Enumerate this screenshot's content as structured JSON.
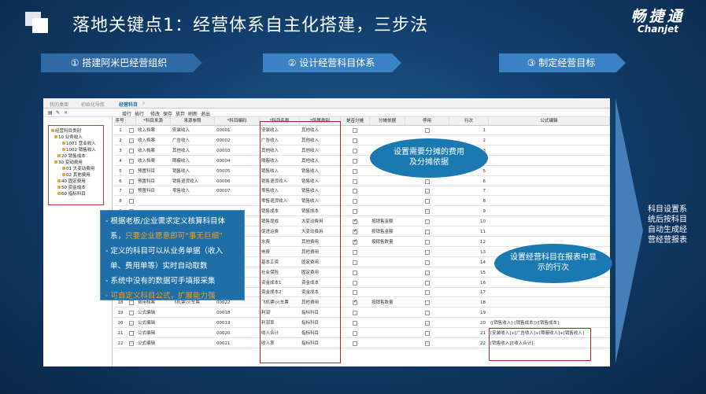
{
  "slide": {
    "title": "落地关键点1：经营体系自主化搭建，三步法",
    "brand_cn": "畅捷通",
    "brand_en": "Chanjet"
  },
  "steps": [
    "① 搭建阿米巴经营组织",
    "② 设计经营科目体系",
    "③ 制定经营目标"
  ],
  "app": {
    "tabs": [
      "我的桌面",
      "初始化导航",
      "经营科目"
    ],
    "toolbar": [
      "增行",
      "插行",
      "修改",
      "保存",
      "放弃",
      "刷新",
      "退出"
    ],
    "tree": [
      "经营科目类别",
      "10 业务收入",
      "1001 营业收入",
      "1002 销售收入",
      "20 销售成本",
      "30 变动费用",
      "01 大变动费用",
      "02 其他费用",
      "40 固定费用",
      "50 资金成本",
      "60 指标科目"
    ],
    "headers": [
      "序号",
      "",
      "*科目来源",
      "来源参照",
      "*科目编码",
      "*科目名称",
      "*所属类别",
      "是否分摊",
      "分摊依据",
      "停用",
      "行次",
      "公式编辑"
    ],
    "rows": [
      [
        "1",
        "收入档案",
        "安装收入",
        "00001",
        "安装收入",
        "其他收入",
        "",
        "",
        "1",
        ""
      ],
      [
        "2",
        "收入档案",
        "广告收入",
        "00002",
        "广告收入",
        "其他收入",
        "",
        "",
        "2",
        ""
      ],
      [
        "3",
        "收入档案",
        "其他收入",
        "00003",
        "其他收入",
        "其他收入",
        "",
        "",
        "3",
        ""
      ],
      [
        "4",
        "收入档案",
        "障蔽收入",
        "00004",
        "障蔽收入",
        "其他收入",
        "",
        "",
        "4",
        ""
      ],
      [
        "5",
        "预置科目",
        "销售收入",
        "00005",
        "销售收入",
        "销售收入",
        "",
        "",
        "5",
        ""
      ],
      [
        "6",
        "预置科目",
        "销售退货收入",
        "00006",
        "销售退货收入",
        "销售收入",
        "",
        "",
        "6",
        ""
      ],
      [
        "7",
        "预置科目",
        "零售收入",
        "00007",
        "零售收入",
        "销售收入",
        "",
        "",
        "7",
        ""
      ],
      [
        "8",
        "",
        "",
        "",
        "零售退货收入",
        "销售收入",
        "",
        "",
        "8",
        ""
      ],
      [
        "9",
        "",
        "",
        "",
        "销售成本",
        "销售成本",
        "",
        "",
        "9",
        ""
      ],
      [
        "10",
        "",
        "",
        "",
        "销售提成",
        "大变动费用",
        "on",
        "按销售金额",
        "10",
        ""
      ],
      [
        "11",
        "",
        "",
        "",
        "促进运费",
        "大变动费用",
        "on",
        "按销售金额",
        "11",
        ""
      ],
      [
        "12",
        "",
        "",
        "",
        "水费",
        "其他费用",
        "on",
        "按销售数量",
        "12",
        ""
      ],
      [
        "13",
        "",
        "",
        "",
        "电费",
        "其他费用",
        "",
        "",
        "13",
        ""
      ],
      [
        "14",
        "",
        "",
        "",
        "基本工资",
        "固定费用",
        "",
        "",
        "14",
        ""
      ],
      [
        "15",
        "",
        "",
        "",
        "社会保险",
        "固定费用",
        "",
        "",
        "15",
        ""
      ],
      [
        "16",
        "",
        "",
        "",
        "资金成本1",
        "资金成本",
        "",
        "",
        "16",
        ""
      ],
      [
        "17",
        "手工编报",
        "",
        "00017",
        "资金成本2",
        "资金成本",
        "",
        "",
        "17",
        ""
      ],
      [
        "18",
        "费用档案",
        "飞机票\\火车票",
        "00022",
        "飞机票\\火车票",
        "其他费用",
        "on",
        "按销售数量",
        "18",
        ""
      ],
      [
        "19",
        "公式编辑",
        "",
        "00018",
        "利润",
        "指标科目",
        "",
        "",
        "19",
        ""
      ],
      [
        "20",
        "公式编辑",
        "",
        "00019",
        "利润率",
        "指标科目",
        "",
        "",
        "20",
        "([销售收入]-[销售成本])/[销售成本]"
      ],
      [
        "21",
        "公式编辑",
        "",
        "00020",
        "收入合计",
        "指标科目",
        "",
        "",
        "21",
        "[安装收入]+[广告收入]+[障蔽收入]+[销售收入]"
      ],
      [
        "22",
        "公式编辑",
        "",
        "00021",
        "收入率",
        "指标科目",
        "",
        "",
        "22",
        "[销售收入]/[收入合计]"
      ]
    ]
  },
  "callouts": [
    "设置需要分摊的费用\n及分摊依据",
    "设置经营科目在报表中显\n示的行次"
  ],
  "note": {
    "l1": "根据老板/企业需求定义核算科目体",
    "l2a": "系，",
    "l2b": "只要企业愿意即可“事无巨细”",
    "l3": "定义的科目可以从业务单据（收入",
    "l4": "单、费用单等）实时自动取数",
    "l5": "系统中没有的数据可手填报采集",
    "l6": "可自定义科目公式，扩展能力强"
  },
  "conclusion": "科目设置系统后按科目自动生成经营经营报表"
}
